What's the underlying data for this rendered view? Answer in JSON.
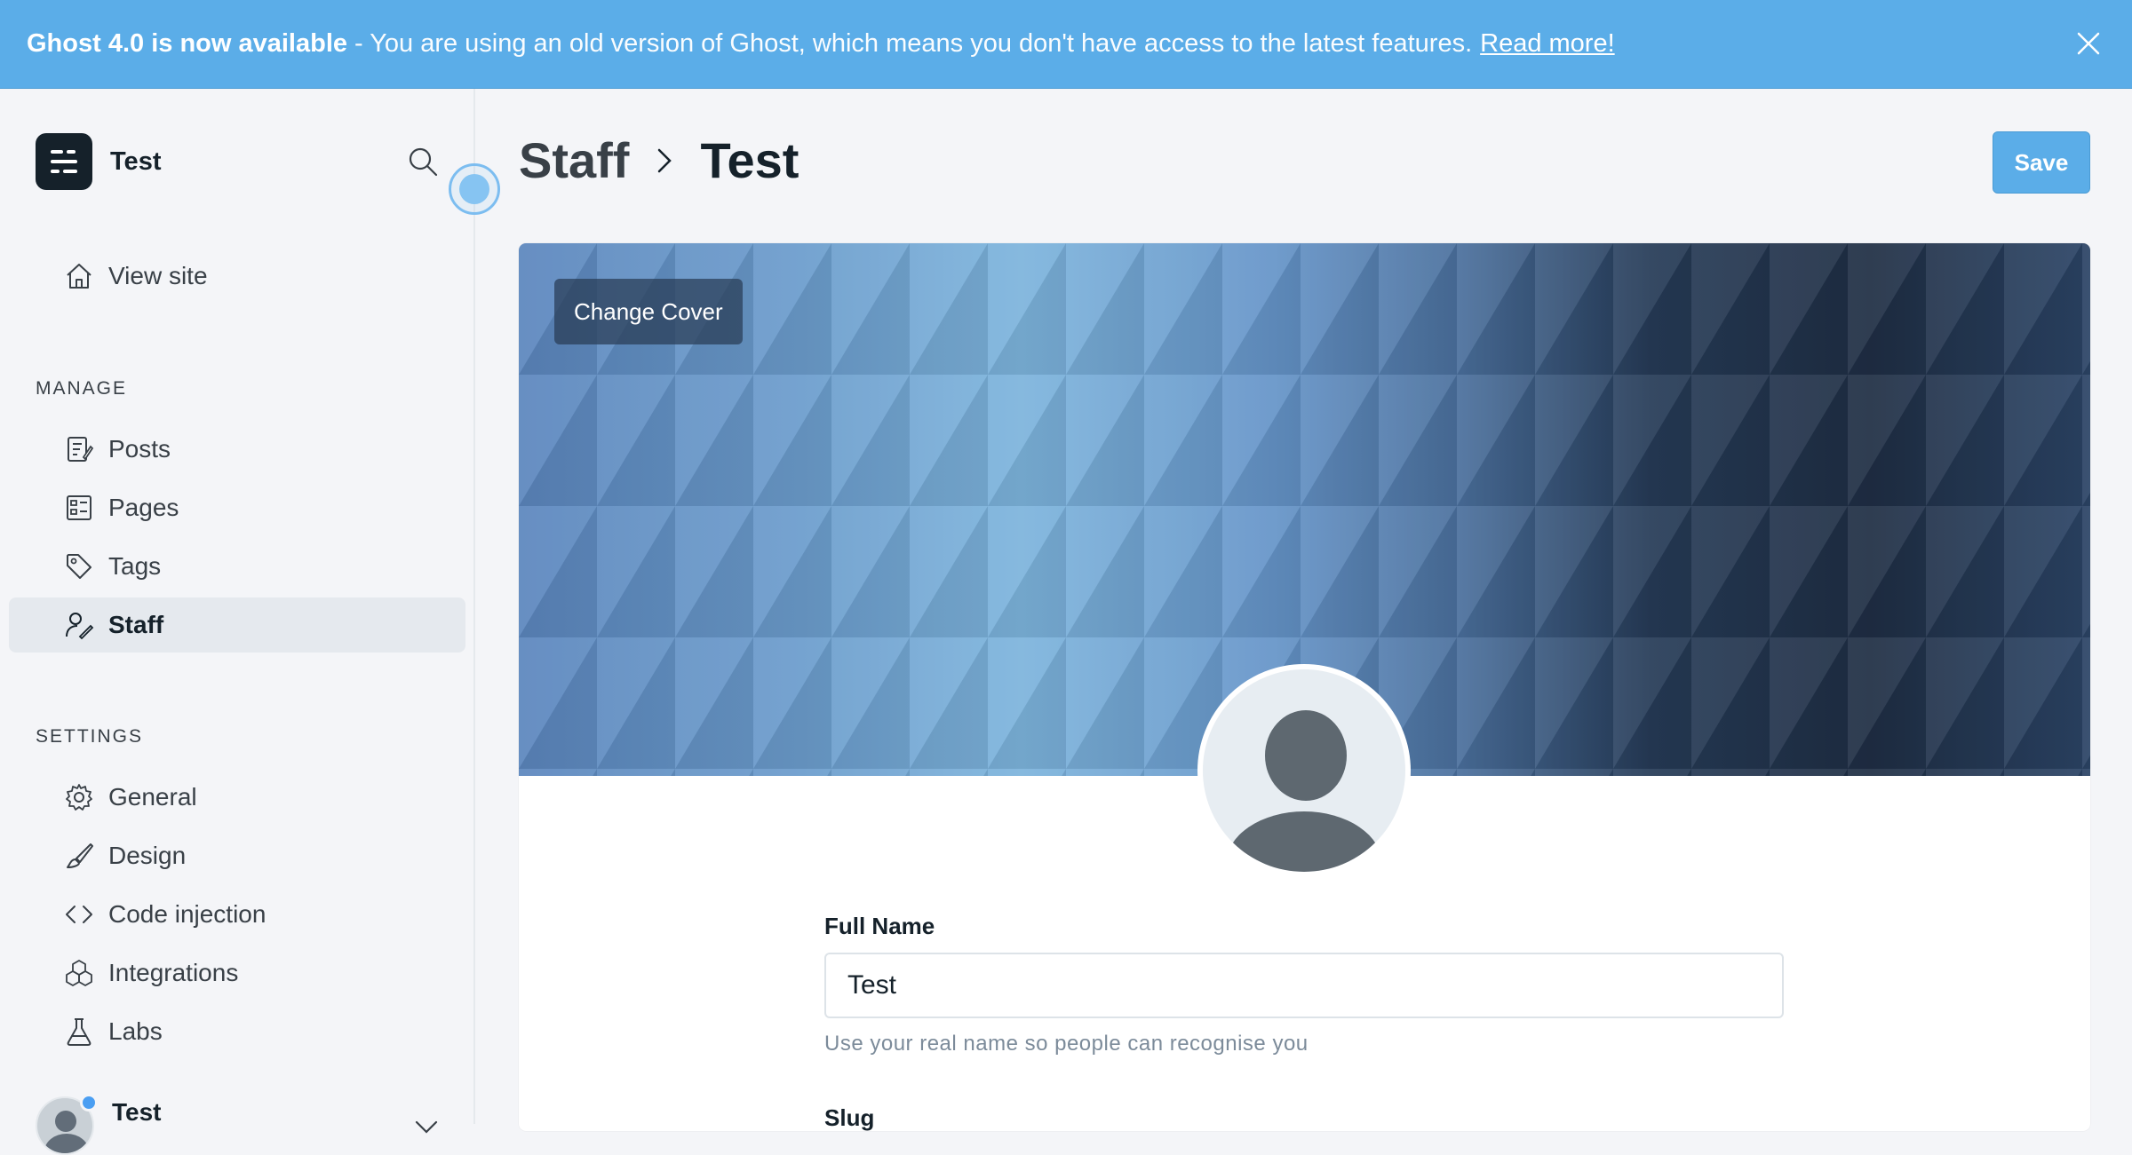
{
  "banner": {
    "title": "Ghost 4.0 is now available",
    "message": "- You are using an old version of Ghost, which means you don't have access to the latest features.",
    "link": "Read more!"
  },
  "sidebar": {
    "site_name": "Test",
    "view_site": "View site",
    "manage_label": "MANAGE",
    "manage_items": [
      {
        "label": "Posts",
        "icon": "posts-icon"
      },
      {
        "label": "Pages",
        "icon": "pages-icon"
      },
      {
        "label": "Tags",
        "icon": "tags-icon"
      },
      {
        "label": "Staff",
        "icon": "staff-icon",
        "active": true
      }
    ],
    "settings_label": "SETTINGS",
    "settings_items": [
      {
        "label": "General",
        "icon": "gear-icon"
      },
      {
        "label": "Design",
        "icon": "brush-icon"
      },
      {
        "label": "Code injection",
        "icon": "code-icon"
      },
      {
        "label": "Integrations",
        "icon": "integrations-icon"
      },
      {
        "label": "Labs",
        "icon": "flask-icon"
      }
    ],
    "user_name": "Test"
  },
  "header": {
    "breadcrumb_parent": "Staff",
    "breadcrumb_current": "Test",
    "save_label": "Save"
  },
  "profile": {
    "change_cover_label": "Change Cover",
    "full_name_label": "Full Name",
    "full_name_value": "Test",
    "full_name_hint": "Use your real name so people can recognise you",
    "slug_label": "Slug"
  },
  "colors": {
    "accent": "#5bade8",
    "text": "#15212a"
  }
}
